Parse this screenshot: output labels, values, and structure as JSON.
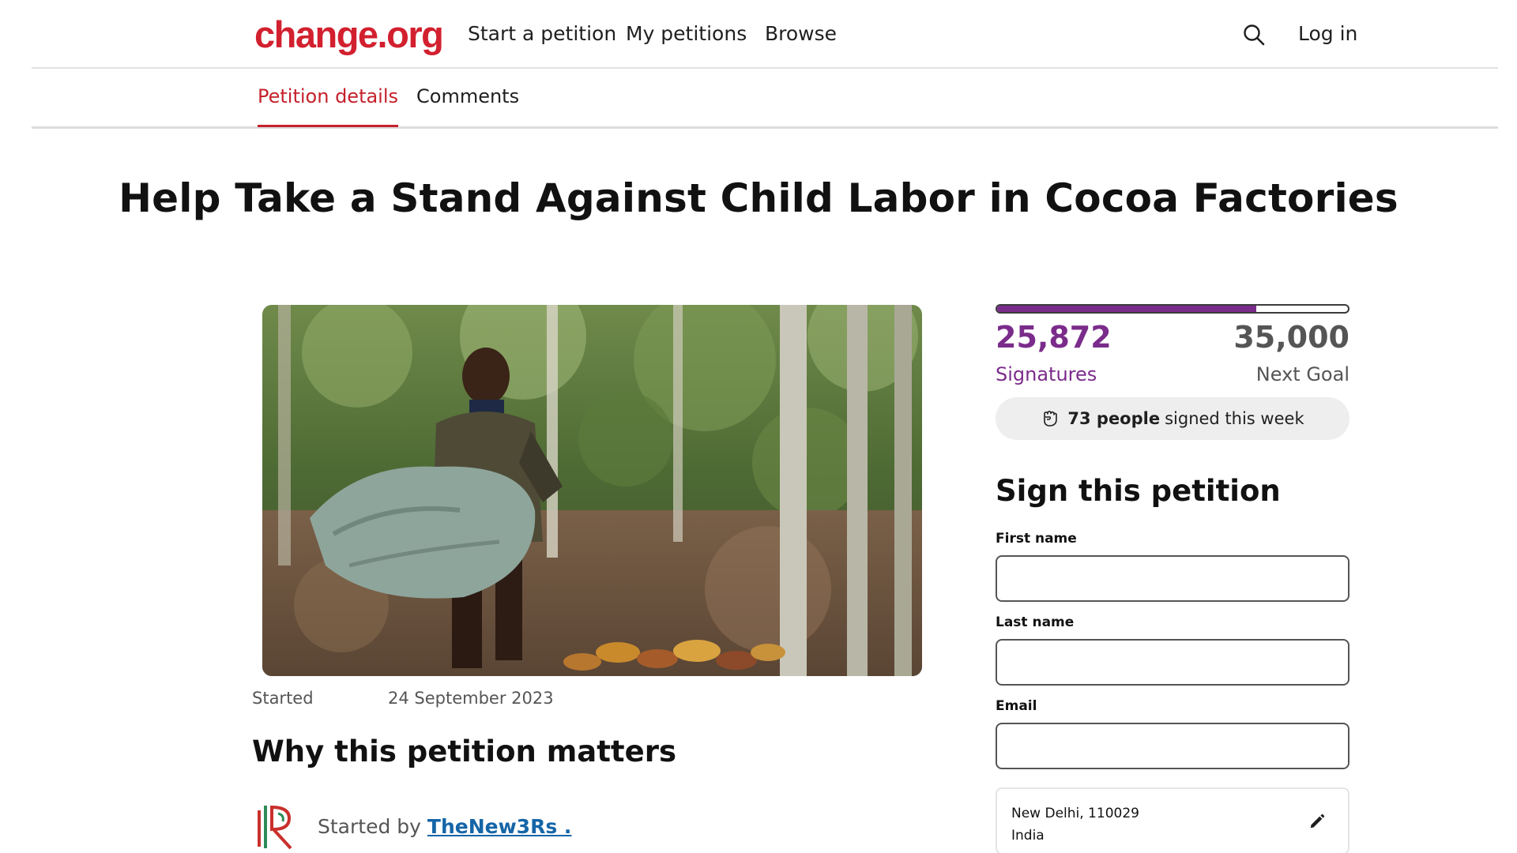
{
  "header": {
    "logo": "change.org",
    "nav": [
      "Start a petition",
      "My petitions",
      "Browse"
    ],
    "search_icon": "search-icon",
    "login_label": "Log in"
  },
  "tabs": [
    "Petition details",
    "Comments"
  ],
  "petition": {
    "title": "Help Take a Stand Against Child Labor in Cocoa Factories",
    "started_label": "Started",
    "started_date": "24 September 2023",
    "why_heading": "Why this petition matters",
    "started_by_prefix": "Started by",
    "started_by_name": "TheNew3Rs ."
  },
  "stats": {
    "signatures": "25,872",
    "signatures_label": "Signatures",
    "goal": "35,000",
    "goal_label": "Next Goal",
    "progress_fraction": 0.739,
    "week_count": "73 people",
    "week_text": "signed this week"
  },
  "form": {
    "heading": "Sign this petition",
    "first_name_label": "First name",
    "first_name_value": "",
    "last_name_label": "Last name",
    "last_name_value": "",
    "email_label": "Email",
    "email_value": "",
    "location_line1": "New Delhi, 110029",
    "location_line2": "India"
  },
  "colors": {
    "brand_red": "#d2202f",
    "tab_active": "#c5212b",
    "signature_purple": "#7b2c8b",
    "link_blue": "#1565a8"
  }
}
